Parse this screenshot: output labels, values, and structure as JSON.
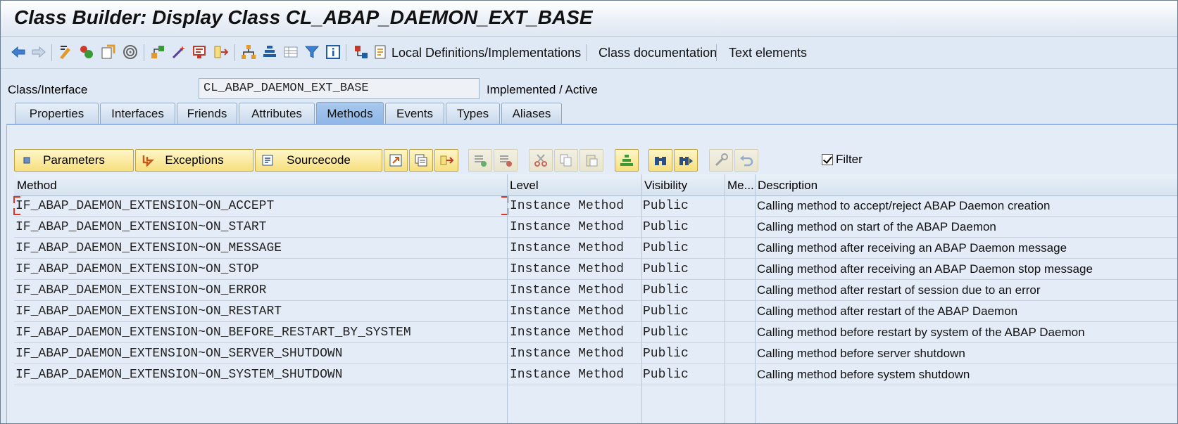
{
  "window": {
    "title": "Class Builder: Display Class CL_ABAP_DAEMON_EXT_BASE"
  },
  "toolbar": {
    "local_definitions": "Local Definitions/Implementations",
    "class_documentation": "Class documentation",
    "text_elements": "Text elements"
  },
  "class_interface": {
    "label": "Class/Interface",
    "value": "CL_ABAP_DAEMON_EXT_BASE",
    "status": "Implemented / Active"
  },
  "tabs": [
    {
      "label": "Properties"
    },
    {
      "label": "Interfaces"
    },
    {
      "label": "Friends"
    },
    {
      "label": "Attributes"
    },
    {
      "label": "Methods"
    },
    {
      "label": "Events"
    },
    {
      "label": "Types"
    },
    {
      "label": "Aliases"
    }
  ],
  "active_tab": "Methods",
  "method_toolbar": {
    "parameters": "Parameters",
    "exceptions": "Exceptions",
    "sourcecode": "Sourcecode",
    "filter": "Filter",
    "filter_checked": true
  },
  "table": {
    "headers": [
      "Method",
      "Level",
      "Visibility",
      "Me...",
      "Description"
    ],
    "rows": [
      {
        "method": "IF_ABAP_DAEMON_EXTENSION~ON_ACCEPT",
        "level": "Instance Method",
        "visibility": "Public",
        "description": "Calling method to accept/reject ABAP Daemon creation"
      },
      {
        "method": "IF_ABAP_DAEMON_EXTENSION~ON_START",
        "level": "Instance Method",
        "visibility": "Public",
        "description": "Calling method on start of the ABAP Daemon"
      },
      {
        "method": "IF_ABAP_DAEMON_EXTENSION~ON_MESSAGE",
        "level": "Instance Method",
        "visibility": "Public",
        "description": "Calling method after receiving an ABAP Daemon message"
      },
      {
        "method": "IF_ABAP_DAEMON_EXTENSION~ON_STOP",
        "level": "Instance Method",
        "visibility": "Public",
        "description": "Calling method after receiving an ABAP Daemon stop message"
      },
      {
        "method": "IF_ABAP_DAEMON_EXTENSION~ON_ERROR",
        "level": "Instance Method",
        "visibility": "Public",
        "description": "Calling method after restart of session due to an error"
      },
      {
        "method": "IF_ABAP_DAEMON_EXTENSION~ON_RESTART",
        "level": "Instance Method",
        "visibility": "Public",
        "description": "Calling method after restart of the ABAP Daemon"
      },
      {
        "method": "IF_ABAP_DAEMON_EXTENSION~ON_BEFORE_RESTART_BY_SYSTEM",
        "level": "Instance Method",
        "visibility": "Public",
        "description": "Calling method before restart by system of the ABAP Daemon"
      },
      {
        "method": "IF_ABAP_DAEMON_EXTENSION~ON_SERVER_SHUTDOWN",
        "level": "Instance Method",
        "visibility": "Public",
        "description": "Calling method before server shutdown"
      },
      {
        "method": "IF_ABAP_DAEMON_EXTENSION~ON_SYSTEM_SHUTDOWN",
        "level": "Instance Method",
        "visibility": "Public",
        "description": "Calling method before system shutdown"
      }
    ]
  },
  "icons": {
    "back": "arrow-left-icon",
    "forward": "arrow-right-icon",
    "colors": {
      "accent": "#1f5fa8",
      "button_yellow": "#f6df7e",
      "active_tab": "#8db6e6",
      "focus_red": "#e0301e"
    }
  }
}
